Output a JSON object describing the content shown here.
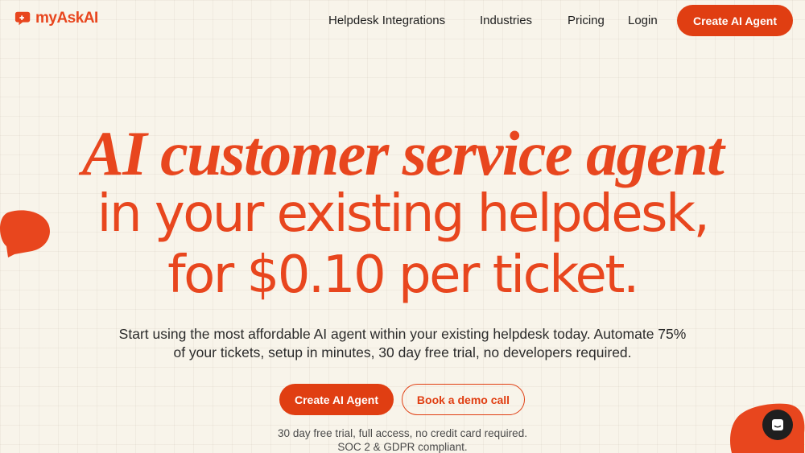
{
  "brand": {
    "name": "myAskAI",
    "accent": "#e8461e",
    "button": "#e03e12"
  },
  "nav": {
    "links": [
      "Helpdesk Integrations",
      "Industries",
      "Pricing",
      "Login"
    ],
    "cta": "Create AI Agent"
  },
  "hero": {
    "line1": "AI customer service agent",
    "line2": "in your existing helpdesk,",
    "line3": "for $0.10 per ticket.",
    "subtitle_line1": "Start using the most affordable AI agent within your existing helpdesk today. Automate 75%",
    "subtitle_line2": "of your tickets, setup in minutes, 30 day free trial, no developers required.",
    "primary_cta": "Create AI Agent",
    "secondary_cta": "Book a demo call",
    "note1": "30 day free trial, full access, no credit card required.",
    "note2": "SOC 2 & GDPR compliant."
  },
  "icons": {
    "logo": "chat-bubble-logo-icon",
    "decor_left": "chat-bubble-decoration-icon",
    "decor_right": "chat-bubble-decoration-icon",
    "launcher": "chat-launcher-icon"
  }
}
